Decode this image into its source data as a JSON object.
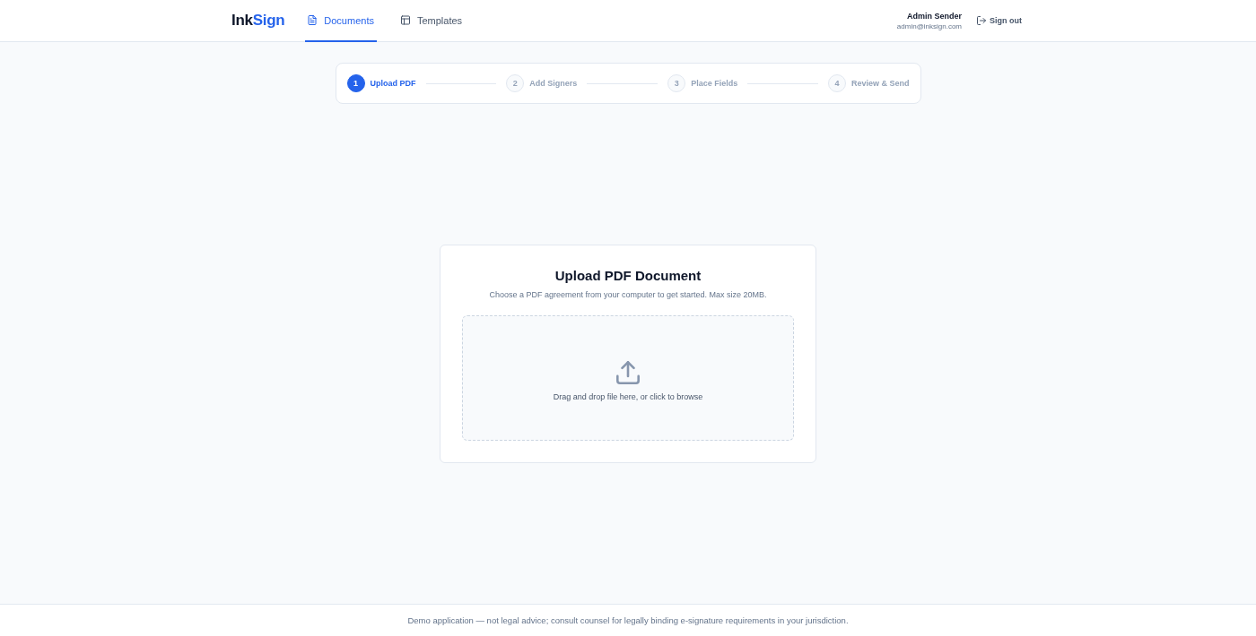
{
  "header": {
    "logo": [
      {
        "text": "Ink",
        "kind": "plain"
      },
      {
        "text": "Sign",
        "kind": "accent"
      }
    ],
    "nav": [
      {
        "label": "Documents",
        "selected": true
      },
      {
        "label": "Templates",
        "selected": false
      }
    ],
    "user": {
      "name": "Admin Sender",
      "email": "admin@inksign.com"
    },
    "sign_out": "Sign out"
  },
  "stepper": {
    "steps": [
      {
        "number": "1",
        "label": "Upload PDF",
        "selected": true
      },
      {
        "number": "2",
        "label": "Add Signers",
        "selected": false
      },
      {
        "number": "3",
        "label": "Place Fields",
        "selected": false
      },
      {
        "number": "4",
        "label": "Review & Send",
        "selected": false
      }
    ]
  },
  "upload": {
    "title": "Upload PDF Document",
    "subtitle": "Choose a PDF agreement from your computer to get started. Max size 20MB.",
    "dropzone": {
      "prompt": "Drag and drop file here, or click to browse"
    }
  },
  "footer": {
    "note": "Demo application — not legal advice; consult counsel for legally binding e-signature requirements in your jurisdiction."
  }
}
